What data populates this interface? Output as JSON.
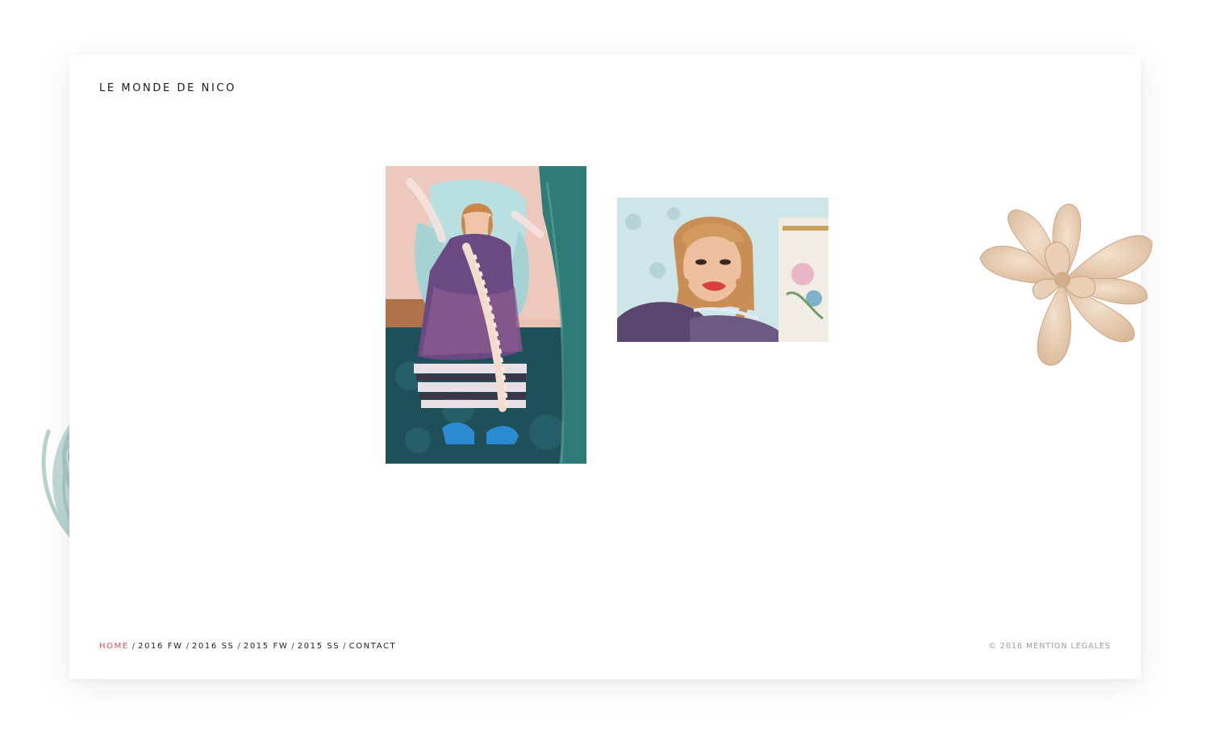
{
  "site": {
    "title": "LE MONDE DE NICO"
  },
  "nav": {
    "items": [
      {
        "label": "HOME",
        "active": true
      },
      {
        "label": "2016 FW",
        "active": false
      },
      {
        "label": "2016 SS",
        "active": false
      },
      {
        "label": "2015 FW",
        "active": false
      },
      {
        "label": "2015 SS",
        "active": false
      },
      {
        "label": "CONTACT",
        "active": false
      }
    ],
    "separator": "/"
  },
  "footer": {
    "legal": "© 2016 MENTION LEGALES"
  },
  "colors": {
    "accent": "#e2494b",
    "text": "#1a1a1a",
    "muted": "#9a9a9a",
    "yarn": "#bcd6d4",
    "flower": "#e6cbb0"
  },
  "gallery": [
    {
      "kind": "photo",
      "subject": "model-seated-in-armchair"
    },
    {
      "kind": "photo",
      "subject": "model-portrait-closeup"
    }
  ],
  "decorations": [
    {
      "icon": "yarn-ball-icon"
    },
    {
      "icon": "paper-flower-icon"
    }
  ]
}
